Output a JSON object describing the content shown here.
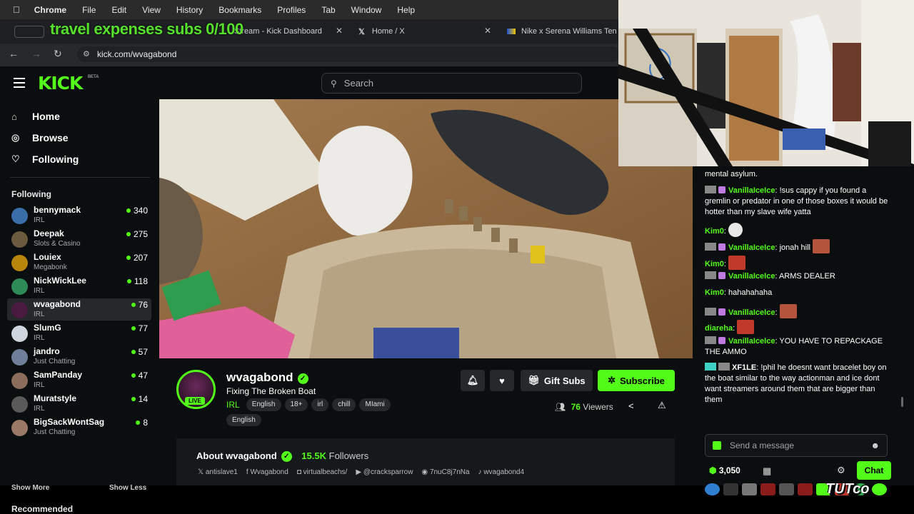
{
  "menubar": {
    "app": "Chrome",
    "items": [
      "File",
      "Edit",
      "View",
      "History",
      "Bookmarks",
      "Profiles",
      "Tab",
      "Window",
      "Help"
    ]
  },
  "overlay": {
    "text": "travel expenses subs 0/100"
  },
  "tabs": [
    {
      "label": "Stream - Kick Dashboard"
    },
    {
      "label": "Home / X"
    },
    {
      "label": "Nike x Serena Williams Ten"
    }
  ],
  "address": {
    "url": "kick.com/wvagabond"
  },
  "header": {
    "logo": "KICK",
    "beta": "BETA",
    "search_placeholder": "Search"
  },
  "nav": [
    {
      "label": "Home",
      "icon": "home-icon"
    },
    {
      "label": "Browse",
      "icon": "compass-icon"
    },
    {
      "label": "Following",
      "icon": "heart-icon"
    }
  ],
  "following_title": "Following",
  "channels": [
    {
      "name": "bennymack",
      "category": "IRL",
      "viewers": "340",
      "color": "#3a6ea8"
    },
    {
      "name": "Deepak",
      "category": "Slots & Casino",
      "viewers": "275",
      "color": "#6b5a3d"
    },
    {
      "name": "Louiex",
      "category": "Megabonk",
      "viewers": "207",
      "color": "#b8860b"
    },
    {
      "name": "NickWickLee",
      "category": "IRL",
      "viewers": "118",
      "color": "#2e8b57"
    },
    {
      "name": "wvagabond",
      "category": "IRL",
      "viewers": "76",
      "color": "#4a1a40"
    },
    {
      "name": "SlumG",
      "category": "IRL",
      "viewers": "77",
      "color": "#cfd6e0"
    },
    {
      "name": "jandro",
      "category": "Just Chatting",
      "viewers": "57",
      "color": "#6f7f9a"
    },
    {
      "name": "SamPanday",
      "category": "IRL",
      "viewers": "47",
      "color": "#8a6d5a"
    },
    {
      "name": "Muratstyle",
      "category": "IRL",
      "viewers": "14",
      "color": "#5a5a5a"
    },
    {
      "name": "BigSackWontSag",
      "category": "Just Chatting",
      "viewers": "8",
      "color": "#9a7a66"
    }
  ],
  "show_more": "Show More",
  "show_less": "Show Less",
  "recommended_title": "Recommended",
  "stream": {
    "channel": "wvagabond",
    "live": "LIVE",
    "title": "Fixing The Broken Boat",
    "category": "IRL",
    "tags": [
      "English",
      "18+",
      "irl",
      "chill",
      "MIami"
    ],
    "tags2": [
      "English"
    ],
    "viewers": "76",
    "viewers_label": "Viewers",
    "gift_label": "Gift Subs",
    "subscribe_label": "Subscribe"
  },
  "about": {
    "title": "About wvagabond",
    "followers": "15.5K",
    "followers_label": "Followers",
    "socials": [
      {
        "icon": "x-icon",
        "label": "antislave1"
      },
      {
        "icon": "facebook-icon",
        "label": "Wvagabond"
      },
      {
        "icon": "instagram-icon",
        "label": "virtualbeachs/"
      },
      {
        "icon": "youtube-icon",
        "label": "@cracksparrow"
      },
      {
        "icon": "discord-icon",
        "label": "7nuC8j7nNa"
      },
      {
        "icon": "tiktok-icon",
        "label": "wvagabond4"
      }
    ]
  },
  "chat": {
    "messages": [
      {
        "user": "",
        "text": "mental asylum."
      },
      {
        "user": "VanillaIceIce",
        "text": "!sus cappy if you found a gremlin or predator in one of those boxes it would be hotter than my slave wife yatta"
      },
      {
        "user": "Kim0",
        "text": ""
      },
      {
        "user": "VanillaIceIce",
        "text": "jonah hill"
      },
      {
        "user": "Kim0",
        "text": ""
      },
      {
        "user": "VanillaIceIce",
        "text": "ARMS DEALER"
      },
      {
        "user": "Kim0",
        "text": "hahahahaha"
      },
      {
        "user": "VanillaIceIce",
        "text": ""
      },
      {
        "user": "diareha",
        "text": ""
      },
      {
        "user": "VanillaIceIce",
        "text": "YOU HAVE TO REPACKAGE THE AMMO"
      },
      {
        "user": "XF1LE",
        "text": "!phil he doesnt want bracelet boy on the boat similar to the way actionman and ice dont want streamers around them that are bigger than them"
      }
    ],
    "placeholder": "Send a message",
    "points": "3,050",
    "chat_button": "Chat"
  },
  "watermark": "TUTco",
  "colors": {
    "accent": "#53fc18",
    "bg": "#0b0e0f",
    "panel": "#16191b"
  }
}
